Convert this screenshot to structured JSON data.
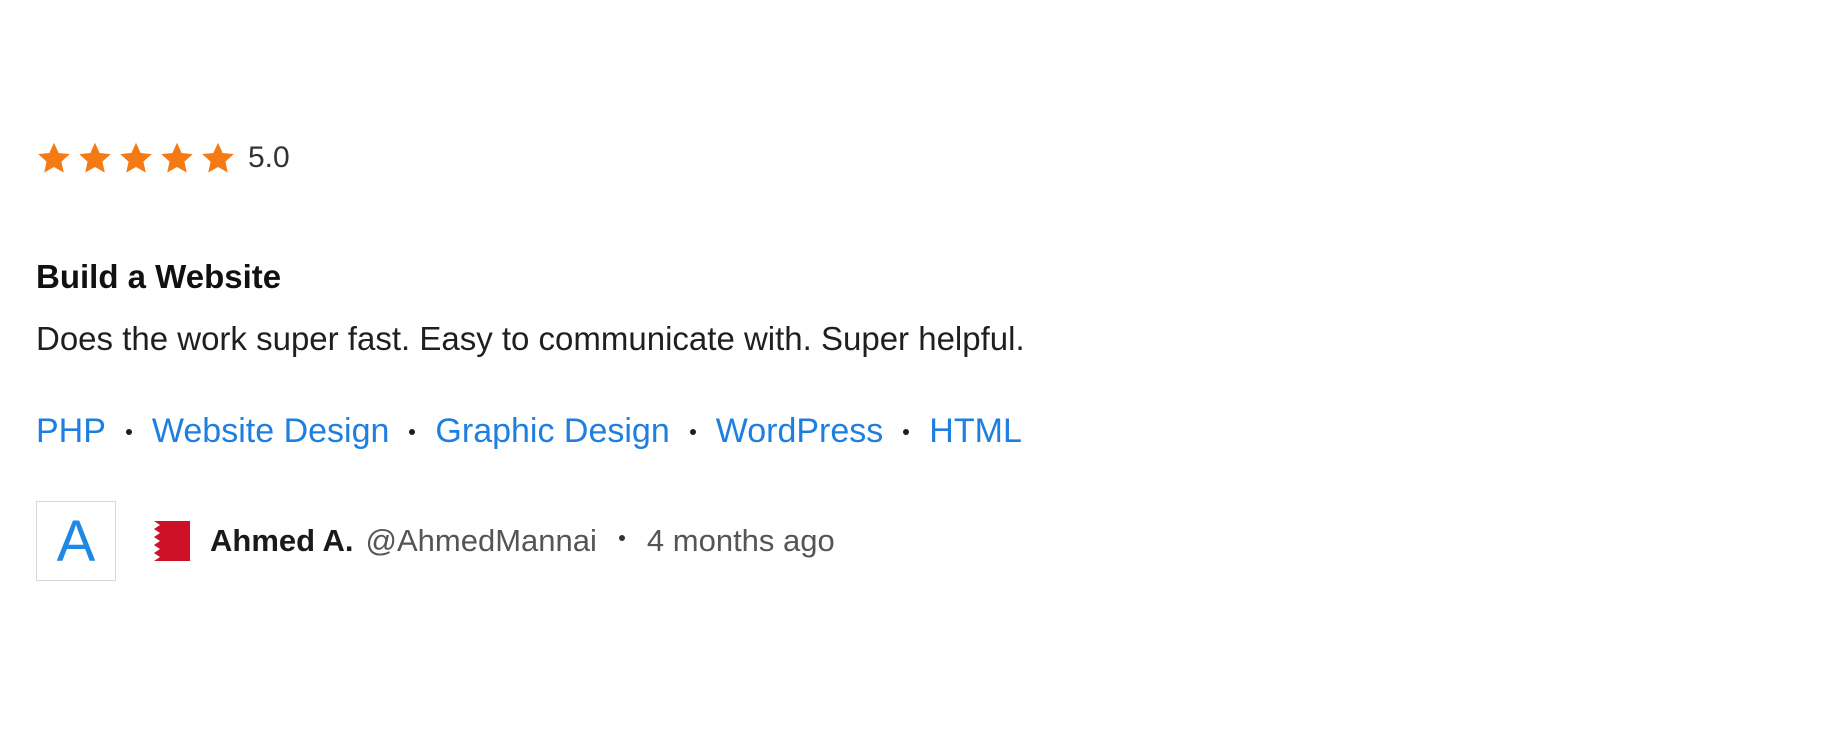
{
  "review": {
    "rating": {
      "stars": 5,
      "max_stars": 5,
      "value_label": "5.0",
      "star_icon": "star-icon",
      "star_color": "#f47a14"
    },
    "title": "Build a Website",
    "text": "Does the work super fast. Easy to communicate with. Super helpful.",
    "skills": [
      {
        "label": "PHP"
      },
      {
        "label": "Website Design"
      },
      {
        "label": "Graphic Design"
      },
      {
        "label": "WordPress"
      },
      {
        "label": "HTML"
      }
    ],
    "skill_color": "#1e7fe0",
    "author": {
      "avatar_letter": "A",
      "avatar_color": "#1e88e5",
      "flag_icon": "bahrain-flag-icon",
      "flag_color": "#ce1126",
      "name": "Ahmed A.",
      "handle": "@AhmedMannai",
      "time": "4 months ago"
    }
  }
}
